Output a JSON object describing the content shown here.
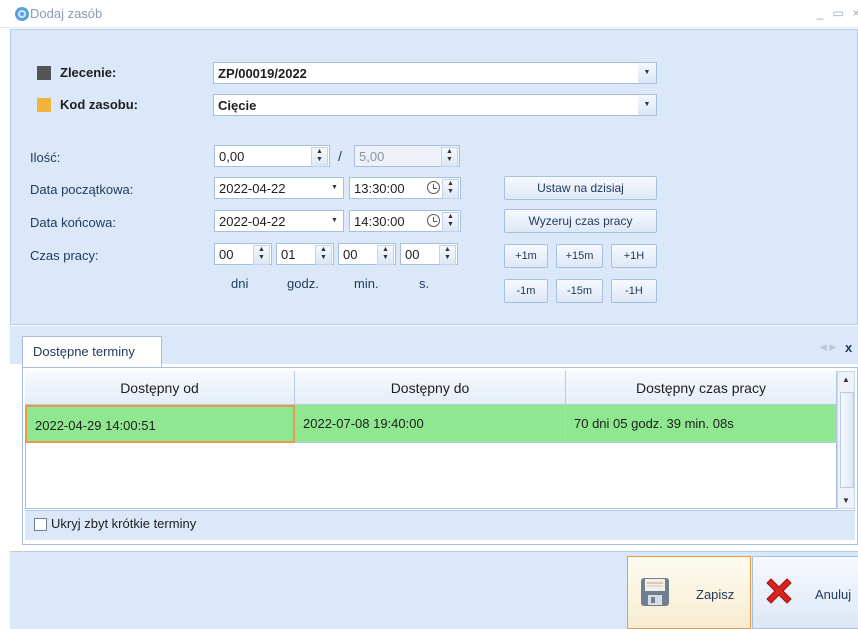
{
  "window": {
    "title": "Dodaj zasób",
    "minimize_glyph": "_",
    "maximize_glyph": "▭",
    "close_glyph": "×"
  },
  "form": {
    "zlecenie": {
      "label": "Zlecenie:",
      "value": "ZP/00019/2022",
      "swatch_color": "#555555"
    },
    "kod_zasobu": {
      "label": "Kod zasobu:",
      "value": "Cięcie",
      "swatch_color": "#f0b43c"
    },
    "ilosc": {
      "label": "Ilość:",
      "value": "0,00",
      "separator": "/",
      "max_value": "5,00"
    },
    "data_poczatkowa": {
      "label": "Data początkowa:",
      "date": "2022-04-22",
      "time": "13:30:00"
    },
    "data_koncowa": {
      "label": "Data końcowa:",
      "date": "2022-04-22",
      "time": "14:30:00"
    },
    "czas_pracy": {
      "label": "Czas pracy:",
      "dni": "00",
      "godz": "01",
      "min": "00",
      "s": "00",
      "units": [
        "dni",
        "godz.",
        "min.",
        "s."
      ]
    },
    "buttons": {
      "ustaw": "Ustaw na dzisiaj",
      "wyzeruj": "Wyzeruj czas pracy",
      "plus": [
        "+1m",
        "+15m",
        "+1H"
      ],
      "minus": [
        "-1m",
        "-15m",
        "-1H"
      ]
    }
  },
  "tab": {
    "label": "Dostępne terminy",
    "close_glyph": "x",
    "columns": [
      "Dostępny od",
      "Dostępny do",
      "Dostępny czas pracy"
    ],
    "rows": [
      {
        "od": "2022-04-29 14:00:51",
        "do": "2022-07-08 19:40:00",
        "czas": "70 dni 05 godz. 39 min. 08s",
        "color": "#8fe88f"
      }
    ],
    "hide_short_label": "Ukryj zbyt krótkie terminy",
    "hide_short_checked": false
  },
  "footer": {
    "save_label": "Zapisz",
    "cancel_label": "Anuluj"
  }
}
